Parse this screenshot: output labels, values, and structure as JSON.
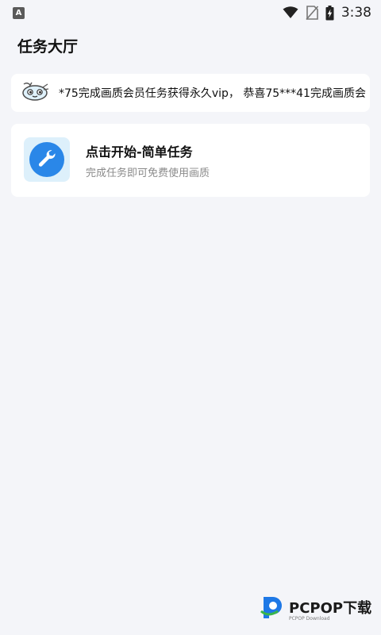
{
  "status_bar": {
    "app_badge": "A",
    "time": "3:38",
    "icons": [
      "wifi-icon",
      "no-sim-icon",
      "battery-charging-icon"
    ]
  },
  "page": {
    "title": "任务大厅"
  },
  "marquee": {
    "icon": "mascot-icon",
    "text": "*75完成画质会员任务获得永久vip， 恭喜75***41完成画质会"
  },
  "task": {
    "icon": "wrench-icon",
    "title": "点击开始-简单任务",
    "subtitle": "完成任务即可免费使用画质"
  },
  "watermark": {
    "brand": "PCPOP下载",
    "sub": "PCPOP Download"
  },
  "colors": {
    "background": "#f4f5f9",
    "card": "#ffffff",
    "accent": "#2a87e8",
    "icon_tint": "#ddf0fb"
  }
}
